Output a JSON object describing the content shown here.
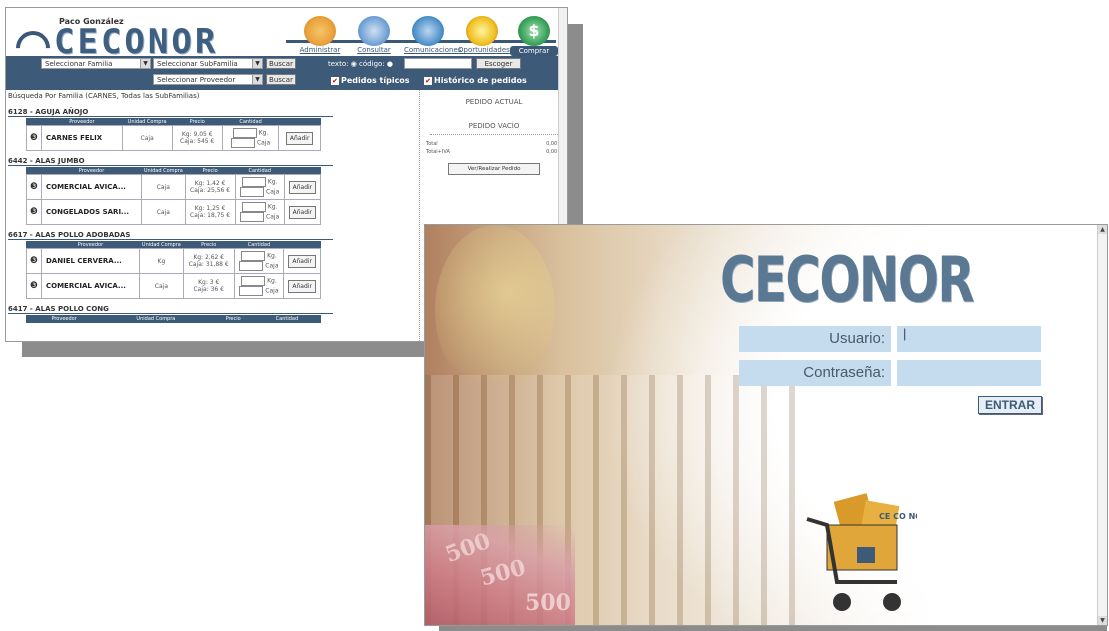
{
  "app": {
    "user_name": "Paco González",
    "logo_text": "CECONOR",
    "nav": [
      {
        "label": "Administrar",
        "icon": "admin-icon",
        "color": "#e9a23b"
      },
      {
        "label": "Consultar",
        "icon": "search-icon",
        "color": "#6e9fd4"
      },
      {
        "label": "Comunicaciones",
        "icon": "communications-icon",
        "color": "#4a8fc8"
      },
      {
        "label": "Oportunidades",
        "icon": "opportunities-star-icon",
        "color": "#f0c020"
      },
      {
        "label": "Comprar",
        "icon": "dollar-icon",
        "color": "#3aa35a"
      }
    ],
    "toolbar": {
      "familia": "Seleccionar Familia",
      "subfamilia": "Seleccionar SubFamilia",
      "proveedor": "Seleccionar Proveedor",
      "buscar1": "Buscar",
      "buscar2": "Buscar",
      "texto_label": "texto:",
      "codigo_label": "código:",
      "escoger": "Escoger",
      "pedidos_tipicos": "Pedidos típicos",
      "historico": "Histórico de pedidos"
    },
    "breadcrumb": "Búsqueda Por Familia (CARNES, Todas las SubFamilias)",
    "headers": [
      "Proveedor",
      "Unidad Compra",
      "Precio",
      "Cantidad"
    ],
    "headers2": [
      "Proveedor",
      "Unidad Compra",
      "Precio",
      "Cantidad"
    ],
    "families": [
      {
        "title": "6128 - AGUJA AÑOJO",
        "rows": [
          {
            "prov": "CARNES FELIX",
            "unit": "Caja",
            "p1": "Kg: 9,05 €",
            "p2": "Caja: 545 €",
            "u1": "Kg.",
            "u2": "Caja",
            "btn": "Añadir"
          }
        ]
      },
      {
        "title": "6442 - ALAS JUMBO",
        "rows": [
          {
            "prov": "COMERCIAL AVICA...",
            "unit": "Caja",
            "p1": "Kg: 1,42 €",
            "p2": "Caja: 25,56 €",
            "u1": "Kg.",
            "u2": "Caja",
            "btn": "Añadir"
          },
          {
            "prov": "CONGELADOS SARI...",
            "unit": "Caja",
            "p1": "Kg: 1,25 €",
            "p2": "Caja: 18,75 €",
            "u1": "Kg.",
            "u2": "Caja",
            "btn": "Añadir"
          }
        ]
      },
      {
        "title": "6617 - ALAS POLLO ADOBADAS",
        "rows": [
          {
            "prov": "DANIEL CERVERA...",
            "unit": "Kg",
            "p1": "Kg: 2,62 €",
            "p2": "Caja: 31,88 €",
            "u1": "Kg.",
            "u2": "Caja",
            "btn": "Añadir"
          },
          {
            "prov": "COMERCIAL AVICA...",
            "unit": "Caja",
            "p1": "Kg: 3 €",
            "p2": "Caja: 36 €",
            "u1": "Kg.",
            "u2": "Caja",
            "btn": "Añadir"
          }
        ]
      },
      {
        "title": "6417 - ALAS POLLO CONG",
        "rows": []
      }
    ],
    "side": {
      "title": "PEDIDO ACTUAL",
      "empty": "PEDIDO VACÍO",
      "total_label": "Total",
      "total_value": "0,00 €",
      "total_iva_label": "Total+IVA",
      "total_iva_value": "0,00 €",
      "button": "Ver/Realizar Pedido"
    }
  },
  "login": {
    "brand": "CECONOR",
    "usuario_label": "Usuario:",
    "usuario_value": "|",
    "contrasena_label": "Contraseña:",
    "contrasena_value": "",
    "enter": "ENTRAR",
    "note_text_1": "500",
    "note_text_2": "500",
    "note_text_3": "500",
    "cart_box_text": "CE CO NOR"
  },
  "colors": {
    "primary": "#3d5a78",
    "login_field": "#c5dbee",
    "brand_text": "#5b7892"
  }
}
